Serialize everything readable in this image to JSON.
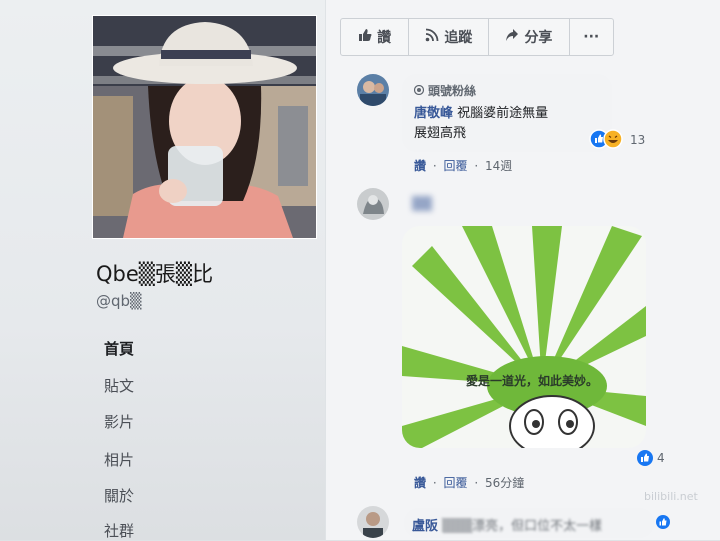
{
  "profile": {
    "name": "Qbe▒張▒比",
    "handle": "@qb▒",
    "nav": [
      "首頁",
      "貼文",
      "影片",
      "相片",
      "關於",
      "社群"
    ]
  },
  "actions": {
    "like": "讚",
    "follow": "追蹤",
    "share": "分享",
    "more": "···"
  },
  "comments": [
    {
      "badge": "頭號粉絲",
      "author": "唐敬峰",
      "text_line1": "祝腦婆前途無量",
      "text_line2": "展翅高飛",
      "reaction_count": "13",
      "like_label": "讚",
      "reply_label": "回覆",
      "time": "14週"
    },
    {
      "author": "▒▒",
      "sticker_text": "愛是一道光，如此美妙。",
      "reaction_count": "4",
      "like_label": "讚",
      "reply_label": "回覆",
      "time": "56分鐘"
    },
    {
      "author": "盧阪",
      "text": "▒▒▒漂亮，但口位不太一樣"
    }
  ],
  "watermark": "bilibili.net",
  "colors": {
    "link": "#385898",
    "like_blue": "#1877f2",
    "haha_yellow": "#f7b125"
  }
}
